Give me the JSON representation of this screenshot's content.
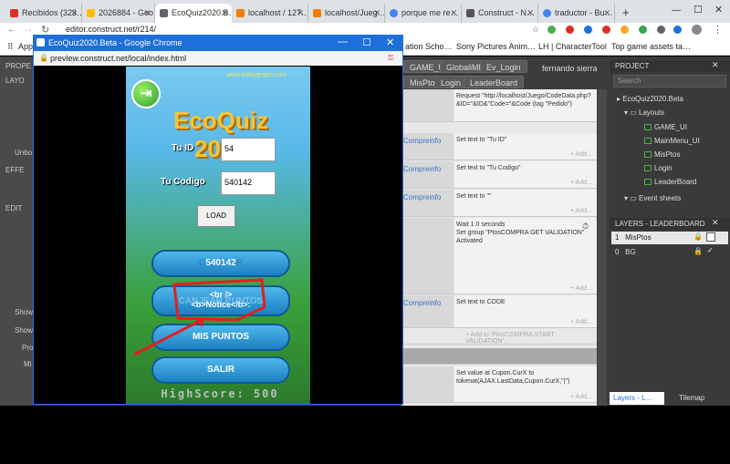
{
  "browser": {
    "tabs": [
      {
        "label": "Recibidos (323…",
        "color": "#d93025"
      },
      {
        "label": "2026884 - Goo…",
        "color": "#fbbc04"
      },
      {
        "label": "EcoQuiz2020.B…",
        "color": "#5f6368"
      },
      {
        "label": "localhost / 127…",
        "color": "#f57c00"
      },
      {
        "label": "localhost/Jueg…",
        "color": "#f57c00"
      },
      {
        "label": "porque me re…",
        "color": "#4285f4"
      },
      {
        "label": "Construct - N…",
        "color": "#555555"
      },
      {
        "label": "traductor - Bu…",
        "color": "#4285f4"
      }
    ],
    "new_tab": "+",
    "url": "editor.construct.net/r214/",
    "bookmarks": [
      "Apps",
      "ation Scho…",
      "Sony Pictures Anim…",
      "LH | CharacterTool",
      "Top game assets ta…"
    ]
  },
  "editor": {
    "left_labels": [
      "PROPE",
      "LAYO",
      "Unbo",
      "EFFE",
      "EDIT",
      "Show",
      "Show",
      "Pro",
      "Mi"
    ],
    "ribbon_tabs": [
      "GAME_UI",
      "GlobaliMP",
      "Ev_Login",
      "MisPtos",
      "Login",
      "LeaderBoard"
    ],
    "user": "fernando sierra",
    "events": [
      {
        "cond": "",
        "action": "Request \"http://localhost/Juego/CodeData.php?&ID=\"&ID&\"Code=\"&Code (tag \"Pedido\")"
      },
      {
        "cond": "Compreinfo",
        "action": "Set text to \"Tu ID\""
      },
      {
        "cond": "Compreinfo",
        "action": "Set text to \"Tu Codigo\""
      },
      {
        "cond": "Compreinfo",
        "action": "Set text to \"\""
      },
      {
        "cond": "",
        "action": "Wait 1.0 seconds\nSet group \"PtosCOMPRA GET VALIDATION\" Activated"
      },
      {
        "cond": "Compreinfo",
        "action": "Set text to CODE"
      },
      {
        "cond": "",
        "action": "Set value at Cupon.CurX to tokenat(AJAX.LastData,Cupon.CurX,\"|\")"
      }
    ],
    "add_action": "+ Add…",
    "add_to_group": "+ Add to 'PtosCOMPRA START VALIDATION'…"
  },
  "project": {
    "title": "PROJECT",
    "search_placeholder": "Search",
    "root": "EcoQuiz2020.Beta",
    "folder_layouts": "Layouts",
    "layouts": [
      "GAME_UI",
      "MainMenu_UI",
      "MisPtos",
      "Login",
      "LeaderBoard"
    ],
    "folder_events": "Event sheets",
    "layers_title": "LAYERS - LEADERBOARD",
    "layers": [
      {
        "index": "1",
        "name": "MisPtos"
      },
      {
        "index": "0",
        "name": "BG"
      }
    ],
    "bottom_tabs": [
      "Layers - L…",
      "Tilemap"
    ]
  },
  "popup": {
    "title": "EcoQuiz2020.Beta - Google Chrome",
    "url": "preview.construct.net/local/index.html",
    "game": {
      "website": "www.kiddygraph.com",
      "logo": "EcoQuiz 2020",
      "id_label": "Tu ID",
      "id_value": "54",
      "code_label": "Tu Codigo",
      "code_value": "540142",
      "load_button": "LOAD",
      "code_display": "540142",
      "notices_text": "<br />\n<b>Notice</b>:",
      "menu_buttons": [
        "CANJEAR",
        "CANJEAR PUNTOS",
        "MIS PUNTOS",
        "SALIR"
      ],
      "highscore": "HighScore: 500"
    }
  },
  "colors": {
    "accent": "#1e6fd9",
    "annotation": "#e02020"
  }
}
